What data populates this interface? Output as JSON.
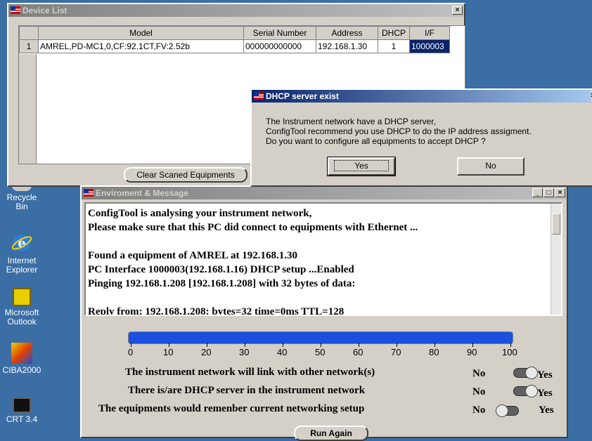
{
  "device_list": {
    "title": "Device List",
    "columns": [
      "Model",
      "Serial Number",
      "Address",
      "DHCP",
      "I/F"
    ],
    "rows": [
      {
        "index": "1",
        "model": "AMREL,PD-MC1,0,CF:92.1CT,FV:2.52b",
        "serial": "000000000000",
        "address": "192.168.1.30",
        "dhcp": "1",
        "if": "1000003"
      }
    ],
    "clear_button": "Clear Scaned Equipments"
  },
  "dialog": {
    "title": "DHCP server exist",
    "line1": "The Instrument network have a DHCP server,",
    "line2": "ConfigTool recommend you use DHCP to do the IP address assigment.",
    "line3": "Do you want to configure all equipments to accept DHCP ?",
    "yes": "Yes",
    "no": "No"
  },
  "env": {
    "title": "Enviroment & Message",
    "log": [
      "ConfigTool is analysing your instrument network,",
      "Please make sure that this PC did connect to equipments with Ethernet ...",
      "",
      "Found a equipment of AMREL at 192.168.1.30",
      "PC Interface 1000003(192.168.1.16) DHCP setup ...Enabled",
      "Pinging 192.168.1.208 [192.168.1.208] with 32 bytes of data:",
      "",
      "Reply from: 192.168.1.208: bytes=32 time=0ms TTL=128"
    ],
    "progress": 100,
    "progress_ticks": [
      "0",
      "10",
      "20",
      "30",
      "40",
      "50",
      "60",
      "70",
      "80",
      "90",
      "100"
    ],
    "options": [
      {
        "label": "The instrument network will link with other network(s)",
        "no": "No",
        "yes": "Yes",
        "state": "yes"
      },
      {
        "label": "There is/are DHCP server in the instrument network",
        "no": "No",
        "yes": "Yes",
        "state": "yes"
      },
      {
        "label": "The equipments would remenber current networking setup",
        "no": "No",
        "yes": "Yes",
        "state": "no"
      }
    ],
    "run_again": "Run Again"
  },
  "desktop": {
    "icons": [
      {
        "label": "Recycle Bin",
        "icon": "recycle-bin-icon"
      },
      {
        "label": "Internet Explorer",
        "icon": "internet-explorer-icon"
      },
      {
        "label": "Microsoft Outlook",
        "icon": "outlook-icon"
      },
      {
        "label": "CIBA2000",
        "icon": "ciba2000-icon"
      },
      {
        "label": "CRT 3.4",
        "icon": "crt-icon"
      }
    ]
  },
  "colors": {
    "desktop": "#3a6ea5",
    "progress": "#1a4fe0",
    "title_active": "#0a246a",
    "selected_cell": "#0a246a"
  }
}
